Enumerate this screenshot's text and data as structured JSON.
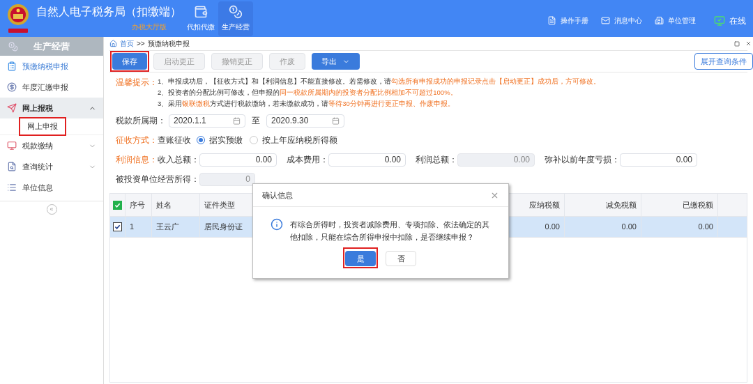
{
  "header": {
    "title": "自然人电子税务局（扣缴端）",
    "subtitle": "办税大厅版",
    "nav": [
      {
        "label": "代扣代缴",
        "selected": false
      },
      {
        "label": "生产经营",
        "selected": true
      }
    ],
    "links": [
      {
        "label": "操作手册"
      },
      {
        "label": "消息中心"
      },
      {
        "label": "单位管理"
      },
      {
        "label": "在线"
      }
    ]
  },
  "sidebar": {
    "title": "生产经营",
    "items": [
      {
        "label": "预缴纳税申报",
        "selected": true
      },
      {
        "label": "年度汇缴申报",
        "selected": false
      },
      {
        "label": "网上报税",
        "selected": false,
        "expanded": true,
        "children": [
          {
            "label": "网上申报",
            "selected": false,
            "annotated": true
          }
        ]
      },
      {
        "label": "税款缴纳",
        "selected": false,
        "expanded": false
      },
      {
        "label": "查询统计",
        "selected": false,
        "expanded": false
      },
      {
        "label": "单位信息",
        "selected": false
      }
    ],
    "collapse": "«"
  },
  "breadcrumb": {
    "home": "首页",
    "separator": ">>",
    "current": "预缴纳税申报"
  },
  "toolbar": {
    "buttons": [
      {
        "label": "保存",
        "kind": "primary",
        "annotated": true
      },
      {
        "label": "启动更正",
        "kind": "disabled",
        "annotated": false
      },
      {
        "label": "撤销更正",
        "kind": "disabled",
        "annotated": false
      },
      {
        "label": "作废",
        "kind": "disabled",
        "annotated": false
      },
      {
        "label": "导出",
        "kind": "dropdown",
        "annotated": false
      }
    ],
    "expand_button": "展开查询条件"
  },
  "notice": {
    "label": "温馨提示：",
    "lines": [
      [
        {
          "text": "1、申报成功后，【征收方式】和【利润信息】不能直接修改。若需修改，请",
          "highlight": false
        },
        {
          "text": "勾选所有申报成功的申报记录点击【启动更正】成功后，方可修改。",
          "highlight": true
        }
      ],
      [
        {
          "text": "2、投资者的分配比例可修改，但申报的",
          "highlight": false
        },
        {
          "text": "同一税款所属期内的投资者分配比例相加不可超过100%。",
          "highlight": true
        }
      ],
      [
        {
          "text": "3、采用",
          "highlight": false
        },
        {
          "text": "银联缴税",
          "highlight": true
        },
        {
          "text": "方式进行税款缴纳，若未缴款成功，请",
          "highlight": false
        },
        {
          "text": "等待30分钟再进行更正申报、作废申报。",
          "highlight": true
        }
      ]
    ]
  },
  "period": {
    "label": "税款所属期：",
    "from": "2020.1.1",
    "to_label": "至",
    "to": "2020.9.30"
  },
  "collection": {
    "label": "征收方式：",
    "method": "查账征收",
    "options": [
      {
        "label": "据实预缴",
        "selected": true
      },
      {
        "label": "按上年应纳税所得额",
        "selected": false
      }
    ]
  },
  "profit": {
    "label": "利润信息：",
    "fields": [
      {
        "label": "收入总额：",
        "value": "0.00",
        "disabled": false
      },
      {
        "label": "成本费用：",
        "value": "0.00",
        "disabled": false
      },
      {
        "label": "利润总额：",
        "value": "0.00",
        "disabled": true
      },
      {
        "label": "弥补以前年度亏损：",
        "value": "0.00",
        "disabled": false
      }
    ]
  },
  "investee": {
    "label": "被投资单位经营所得：",
    "value": "0",
    "disabled": true
  },
  "table": {
    "all_checked": true,
    "columns": [
      "序号",
      "姓名",
      "证件类型",
      "应纳税额",
      "减免税额",
      "已缴税额"
    ],
    "rows": [
      {
        "checked": true,
        "selected": true,
        "cells": [
          "1",
          "王云广",
          "居民身份证",
          "0.00",
          "0.00",
          "0.00"
        ]
      }
    ]
  },
  "dialog": {
    "title": "确认信息",
    "message": "有综合所得时，投资者减除费用、专项扣除、依法确定的其他扣除，只能在综合所得申报中扣除，是否继续申报？",
    "buttons": [
      {
        "label": "是",
        "kind": "primary",
        "annotated": true
      },
      {
        "label": "否",
        "kind": "default",
        "annotated": false
      }
    ]
  }
}
